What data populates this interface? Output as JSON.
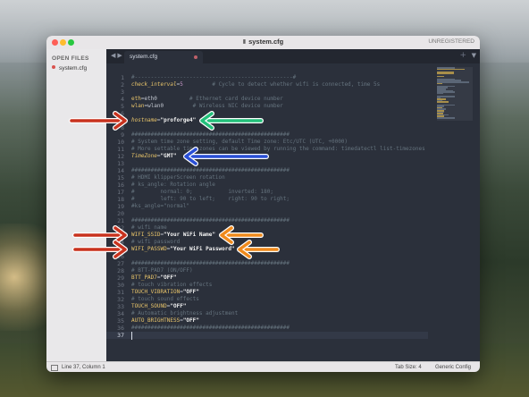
{
  "window": {
    "title": "system.cfg",
    "badge": "UNREGISTERED"
  },
  "sidebar": {
    "heading": "OPEN FILES",
    "files": [
      "system.cfg"
    ]
  },
  "tabs": [
    {
      "label": "system.cfg",
      "modified": true
    }
  ],
  "editor": {
    "active_line": 37,
    "lines": [
      {
        "n": 1,
        "tokens": [
          [
            "#-------------------------------------------------#",
            "comment"
          ]
        ]
      },
      {
        "n": 2,
        "tokens": [
          [
            "check_interval",
            "key"
          ],
          [
            "=",
            "eq"
          ],
          [
            "5",
            "num"
          ],
          [
            "         # Cycle to detect whether wifi is connected, time 5s",
            "comment"
          ]
        ]
      },
      {
        "n": 3,
        "tokens": []
      },
      {
        "n": 4,
        "tokens": [
          [
            "eth",
            "keyn"
          ],
          [
            "=eth0",
            "plain"
          ],
          [
            "          # Ethernet card device number",
            "comment"
          ]
        ]
      },
      {
        "n": 5,
        "tokens": [
          [
            "wlan",
            "keyn"
          ],
          [
            "=wlan0",
            "plain"
          ],
          [
            "         # Wireless NIC device number",
            "comment"
          ]
        ]
      },
      {
        "n": 6,
        "tokens": []
      },
      {
        "n": 7,
        "tokens": [
          [
            "hostname",
            "key"
          ],
          [
            "=",
            "eq"
          ],
          [
            "\"proforge4\"",
            "str"
          ]
        ]
      },
      {
        "n": 8,
        "tokens": []
      },
      {
        "n": 9,
        "tokens": [
          [
            "#################################################",
            "comment"
          ]
        ]
      },
      {
        "n": 10,
        "tokens": [
          [
            "# System time zone setting, default Time zone: Etc/UTC (UTC, +0000)",
            "comment"
          ]
        ]
      },
      {
        "n": 11,
        "tokens": [
          [
            "# More settable time zones can be viewed by running the command: timedatectl list-timezones",
            "comment"
          ]
        ]
      },
      {
        "n": 12,
        "tokens": [
          [
            "TimeZone",
            "key"
          ],
          [
            "=",
            "eq"
          ],
          [
            "\"GMT\"",
            "str"
          ]
        ]
      },
      {
        "n": 13,
        "tokens": []
      },
      {
        "n": 14,
        "tokens": [
          [
            "#################################################",
            "comment"
          ]
        ]
      },
      {
        "n": 15,
        "tokens": [
          [
            "# HDMI klipperScreen rotation",
            "comment"
          ]
        ]
      },
      {
        "n": 16,
        "tokens": [
          [
            "# ks_angle: Rotation angle",
            "comment"
          ]
        ]
      },
      {
        "n": 17,
        "tokens": [
          [
            "#        normal: 0;           inverted: 180;",
            "comment"
          ]
        ]
      },
      {
        "n": 18,
        "tokens": [
          [
            "#        left: 90 to left;    right: 90 to right;",
            "comment"
          ]
        ]
      },
      {
        "n": 19,
        "tokens": [
          [
            "#ks_angle=\"normal\"",
            "comment"
          ]
        ]
      },
      {
        "n": 20,
        "tokens": []
      },
      {
        "n": 21,
        "tokens": [
          [
            "#################################################",
            "comment"
          ]
        ]
      },
      {
        "n": 22,
        "tokens": [
          [
            "# wifi name",
            "comment"
          ]
        ]
      },
      {
        "n": 23,
        "tokens": [
          [
            "WIFI_SSID",
            "keyn"
          ],
          [
            "=",
            "eq"
          ],
          [
            "\"Your WiFi Name\"",
            "str"
          ]
        ]
      },
      {
        "n": 24,
        "tokens": [
          [
            "# wifi password",
            "comment"
          ]
        ]
      },
      {
        "n": 25,
        "tokens": [
          [
            "WIFI_PASSWD",
            "keyn"
          ],
          [
            "=",
            "eq"
          ],
          [
            "\"Your WiFi Password\"",
            "str"
          ]
        ]
      },
      {
        "n": 26,
        "tokens": []
      },
      {
        "n": 27,
        "tokens": [
          [
            "#################################################",
            "comment"
          ]
        ]
      },
      {
        "n": 28,
        "tokens": [
          [
            "# BTT-PAD7 (ON/OFF)",
            "comment"
          ]
        ]
      },
      {
        "n": 29,
        "tokens": [
          [
            "BTT_PAD7",
            "keyn"
          ],
          [
            "=",
            "eq"
          ],
          [
            "\"OFF\"",
            "str"
          ]
        ]
      },
      {
        "n": 30,
        "tokens": [
          [
            "# touch vibration effects",
            "comment"
          ]
        ]
      },
      {
        "n": 31,
        "tokens": [
          [
            "TOUCH_VIBRATION",
            "keyn"
          ],
          [
            "=",
            "eq"
          ],
          [
            "\"OFF\"",
            "str"
          ]
        ]
      },
      {
        "n": 32,
        "tokens": [
          [
            "# touch sound effects",
            "comment"
          ]
        ]
      },
      {
        "n": 33,
        "tokens": [
          [
            "TOUCH_SOUND",
            "keyn"
          ],
          [
            "=",
            "eq"
          ],
          [
            "\"OFF\"",
            "str"
          ]
        ]
      },
      {
        "n": 34,
        "tokens": [
          [
            "# Automatic brightness adjustment",
            "comment"
          ]
        ]
      },
      {
        "n": 35,
        "tokens": [
          [
            "AUTO_BRIGHTNESS",
            "keyn"
          ],
          [
            "=",
            "eq"
          ],
          [
            "\"OFF\"",
            "str"
          ]
        ]
      },
      {
        "n": 36,
        "tokens": [
          [
            "#################################################",
            "comment"
          ]
        ]
      },
      {
        "n": 37,
        "tokens": []
      }
    ]
  },
  "annotations": [
    {
      "target_line": 7,
      "side": "left",
      "color": "#c8321e"
    },
    {
      "target_line": 7,
      "side": "right",
      "color": "#22c07a"
    },
    {
      "target_line": 12,
      "side": "right",
      "color": "#2a4fd6"
    },
    {
      "target_line": 23,
      "side": "left",
      "color": "#c8321e"
    },
    {
      "target_line": 23,
      "side": "right",
      "color": "#f08a1c"
    },
    {
      "target_line": 25,
      "side": "left",
      "color": "#c8321e"
    },
    {
      "target_line": 25,
      "side": "right",
      "color": "#f08a1c"
    }
  ],
  "statusbar": {
    "position": "Line 37, Column 1",
    "tab_size": "Tab Size: 4",
    "syntax": "Generic Config"
  }
}
